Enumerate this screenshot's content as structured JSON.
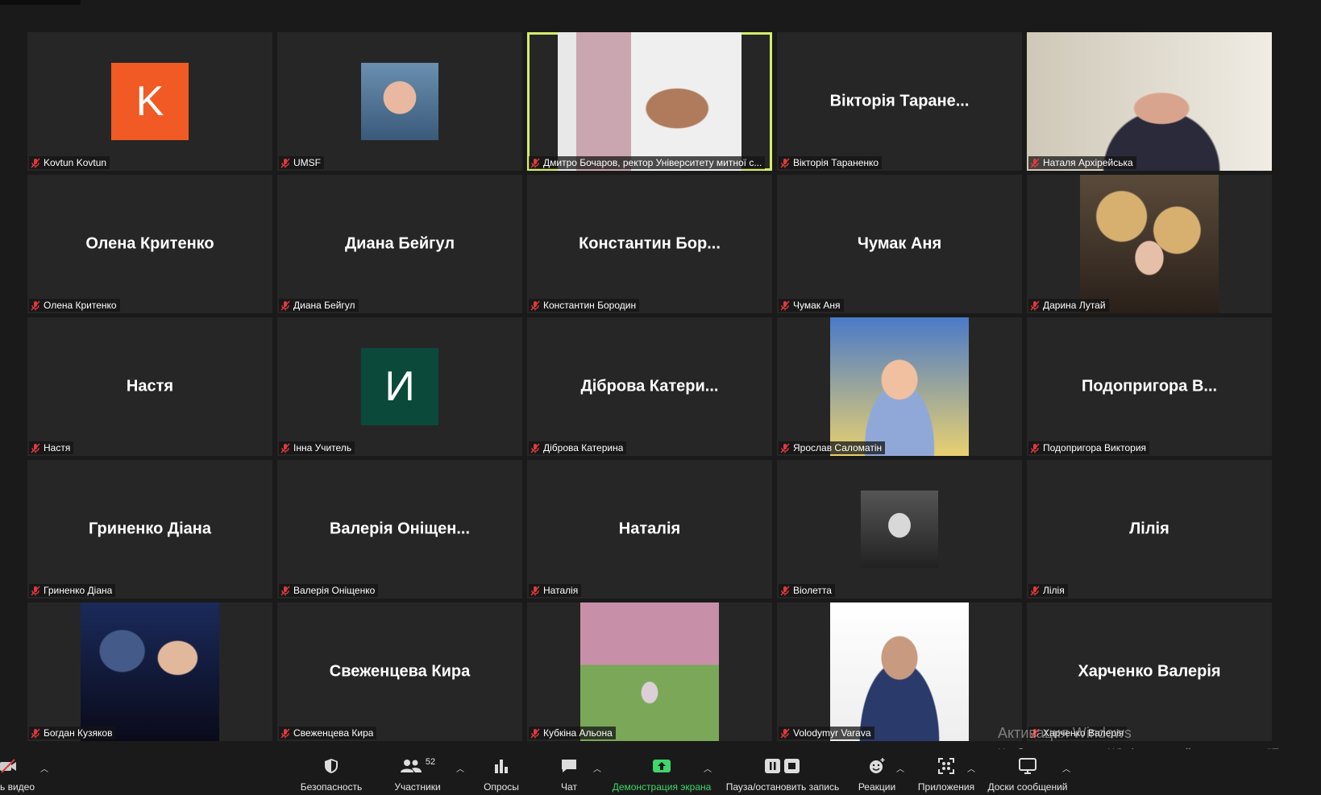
{
  "tiles": [
    {
      "type": "avatar",
      "letter": "K",
      "avatar_color": "#f15a24",
      "label": "Kovtun Kovtun"
    },
    {
      "type": "photo",
      "photo_kind": "man-portrait",
      "label": "UMSF"
    },
    {
      "type": "photo",
      "photo_kind": "speaker-video",
      "active": true,
      "label": "Дмитро Бочаров, ректор Університету митної с..."
    },
    {
      "type": "name",
      "big_name": "Вікторія Таране...",
      "label": "Вікторія Тараненко"
    },
    {
      "type": "photo",
      "photo_kind": "woman-video",
      "label": "Наталя Архірейська"
    },
    {
      "type": "name",
      "big_name": "Олена Критенко",
      "label": "Олена Критенко"
    },
    {
      "type": "name",
      "big_name": "Диана Бейгул",
      "label": "Диана Бейгул"
    },
    {
      "type": "name",
      "big_name": "Константин  Бор...",
      "label": "Константин Бородин"
    },
    {
      "type": "name",
      "big_name": "Чумак Аня",
      "label": "Чумак Аня"
    },
    {
      "type": "photo",
      "photo_kind": "balloons",
      "label": "Дарина Лутай"
    },
    {
      "type": "name",
      "big_name": "Настя",
      "label": "Настя"
    },
    {
      "type": "avatar",
      "letter": "И",
      "avatar_color": "#0b4a3a",
      "label": "Інна Учитель"
    },
    {
      "type": "name",
      "big_name": "Діброва  Катери...",
      "label": "Діброва Катерина"
    },
    {
      "type": "photo",
      "photo_kind": "cartoon",
      "label": "Ярослав Саломатін"
    },
    {
      "type": "name",
      "big_name": "Подопригора  В...",
      "label": "Подопригора Виктория"
    },
    {
      "type": "name",
      "big_name": "Гриненко Діана",
      "label": "Гриненко Діана"
    },
    {
      "type": "name",
      "big_name": "Валерія Оніщен...",
      "label": "Валерія Оніщенко"
    },
    {
      "type": "name",
      "big_name": "Наталія",
      "label": "Наталія"
    },
    {
      "type": "photo",
      "photo_kind": "bw-portrait",
      "label": "Віолетта"
    },
    {
      "type": "name",
      "big_name": "Лілія",
      "label": "Лілія"
    },
    {
      "type": "photo",
      "photo_kind": "hero",
      "label": "Богдан Кузяков"
    },
    {
      "type": "name",
      "big_name": "Свеженцева Кира",
      "label": "Свеженцева Кира"
    },
    {
      "type": "photo",
      "photo_kind": "park",
      "label": "Кубкіна Альона"
    },
    {
      "type": "photo",
      "photo_kind": "uniform",
      "label": "Volodymyr Varava"
    },
    {
      "type": "name",
      "big_name": "Харченко Валерія",
      "label": "Харченко Валерія"
    }
  ],
  "watermark": {
    "title": "Активация Windows",
    "subtitle": "Чтобы активировать Windows, перейдите в раздел \"Пара"
  },
  "toolbar": {
    "video": "ь видео",
    "security": "Безопасность",
    "participants": "Участники",
    "participants_count": "52",
    "polls": "Опросы",
    "chat": "Чат",
    "share": "Демонстрация экрана",
    "record": "Пауза/остановить запись",
    "reactions": "Реакции",
    "apps": "Приложения",
    "whiteboards": "Доски сообщений"
  },
  "colors": {
    "active_border": "#d4ee6a",
    "share_green": "#3fd66b",
    "mute_red": "#e0393e",
    "tile_bg": "#262626"
  }
}
